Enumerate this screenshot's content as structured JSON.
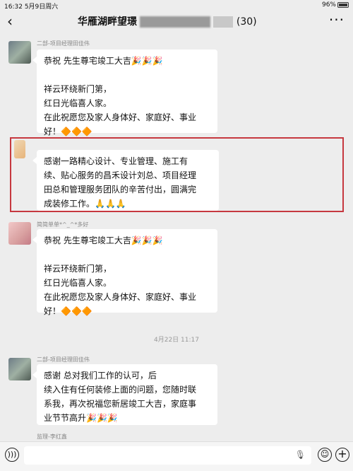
{
  "status_bar": {
    "time": "16:32",
    "date": "5月9日周六",
    "battery": "96%"
  },
  "header": {
    "back_icon": "‹",
    "title": "华雁湖畔望璟",
    "count": "(30)",
    "more_icon": "···"
  },
  "messages": [
    {
      "sender": "二部-项目经理田佳伟",
      "lines": [
        "恭祝 先生尊宅竣工大吉🎉🎉🎉",
        "",
        "祥云环绕新门第，",
        "红日光临喜人家。",
        "在此祝愿您及家人身体好、家庭好、事业",
        "好！🔶🔶🔶"
      ]
    },
    {
      "sender": "",
      "lines": [
        "感谢一路精心设计、专业管理、施工有",
        "续、贴心服务的昌禾设计刘总、项目经理",
        "田总和管理服务团队的辛苦付出，圆满完",
        "成装修工作。🙏🙏🙏"
      ]
    },
    {
      "sender": "简简单单*^_^*多好",
      "lines": [
        "恭祝 先生尊宅竣工大吉🎉🎉🎉",
        "",
        "祥云环绕新门第，",
        "红日光临喜人家。",
        "在此祝愿您及家人身体好、家庭好、事业",
        "好！🔶🔶🔶"
      ]
    },
    {
      "sender": "二部-项目经理田佳伟",
      "lines": [
        "感谢 总对我们工作的认可，后",
        "续入住有任何装修上面的问题，您随时联",
        "系我，再次祝福您新居竣工大吉，家庭事",
        "业节节高升🎉🎉🎉"
      ]
    }
  ],
  "timestamp": "4月22日 11:17",
  "last_sender": "监理-李红鑫",
  "input": {
    "placeholder": ""
  }
}
